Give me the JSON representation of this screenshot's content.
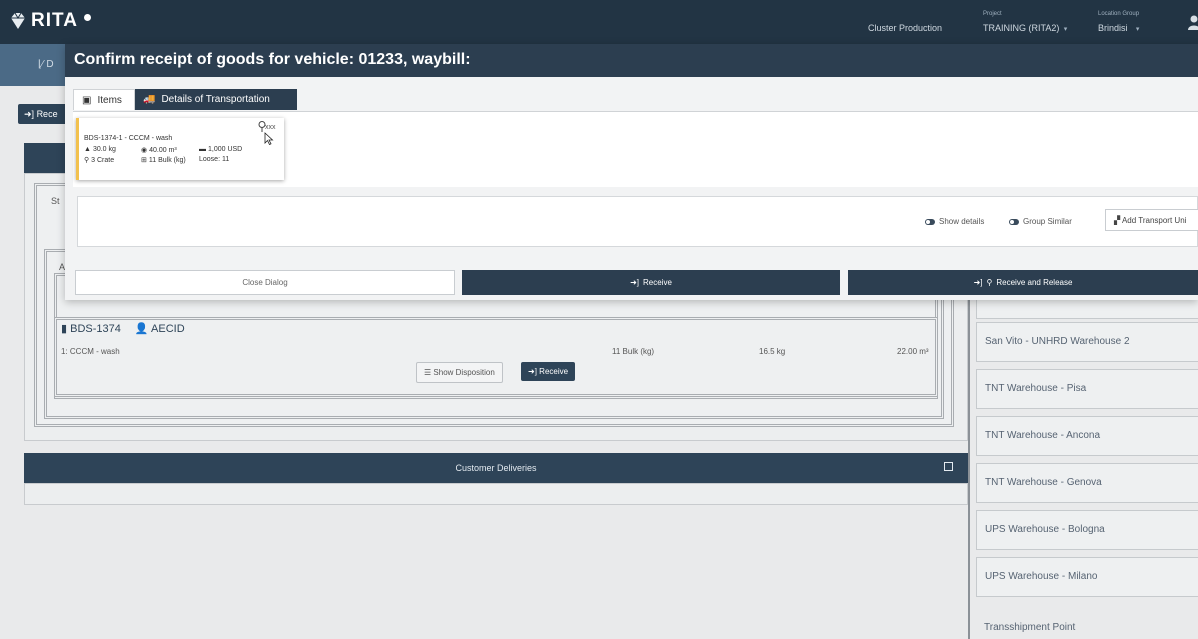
{
  "app": {
    "logo_text": "RITA",
    "cluster": "Cluster Production",
    "project_label": "Project",
    "project_value": "TRAINING (RITA2)",
    "location_group_label": "Location Group",
    "location_group_value": "Brindisi"
  },
  "background": {
    "nav_left_text": "D",
    "receive_button_label": "Rece",
    "status_partial": "St",
    "tab_partial": "A",
    "document": {
      "code": "BDS-1374",
      "organization": "AECID",
      "row": {
        "item": "1: CCCM - wash",
        "quantity": "11 Bulk (kg)",
        "weight": "16.5 kg",
        "volume": "22.00 m³"
      },
      "show_disposition_label": "Show Disposition",
      "receive_label": "Receive"
    },
    "customer_deliveries_title": "Customer Deliveries"
  },
  "warehouses": [
    "San Vito - UNHRD Warehouse 2",
    "TNT Warehouse - Pisa",
    "TNT Warehouse - Ancona",
    "TNT Warehouse - Genova",
    "UPS Warehouse - Bologna",
    "UPS Warehouse - Milano"
  ],
  "transshipment_label": "Transshipment Point",
  "modal": {
    "title": "Confirm receipt of goods for vehicle: 01233, waybill:",
    "tabs": {
      "items": "Items",
      "transport": "Details of Transportation"
    },
    "item_card": {
      "name": "BDS-1374-1 - CCCM - wash",
      "menu": "xxx",
      "weight": "30.0 kg",
      "volume": "40.00 m³",
      "value": "1,000 USD",
      "crates": "3 Crate",
      "bulk": "11 Bulk (kg)",
      "loose": "Loose: 11"
    },
    "options": {
      "show_details": "Show details",
      "group_similar": "Group Similar",
      "add_transport_unit": "Add Transport Uni"
    },
    "buttons": {
      "close": "Close Dialog",
      "receive": "Receive",
      "receive_release": "Receive and Release"
    }
  },
  "colors": {
    "header_dark": "#223444",
    "modal_title": "#2c3e50",
    "nav_blue": "#4b6a86",
    "card_accent": "#f2c14e"
  }
}
